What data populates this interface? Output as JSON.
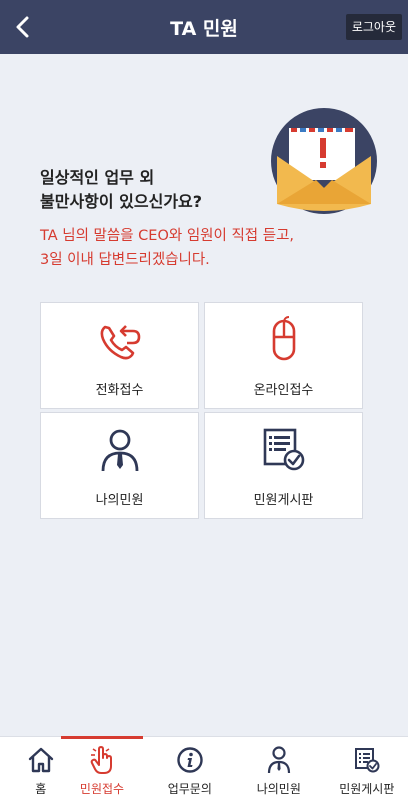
{
  "header": {
    "title": "TA 민원",
    "logout_label": "로그아웃"
  },
  "intro": {
    "headline_line1": "일상적인 업무 외",
    "headline_line2": "불만사항이 있으신가요?",
    "sub_line1": "TA 님의 말씀을 CEO와 임원이 직접 듣고,",
    "sub_line2": "3일 이내 답변드리겠습니다."
  },
  "menu": {
    "items": [
      {
        "label": "전화접수",
        "icon": "phone-callback-icon"
      },
      {
        "label": "온라인접수",
        "icon": "mouse-icon"
      },
      {
        "label": "나의민원",
        "icon": "person-tie-icon"
      },
      {
        "label": "민원게시판",
        "icon": "board-check-icon"
      }
    ]
  },
  "tabs": {
    "items": [
      {
        "label": "홈",
        "icon": "home-icon"
      },
      {
        "label": "민원접수",
        "icon": "hand-pointer-icon"
      },
      {
        "label": "업무문의",
        "icon": "info-icon"
      },
      {
        "label": "나의민원",
        "icon": "person-tie-icon"
      },
      {
        "label": "민원게시판",
        "icon": "board-check-icon"
      }
    ],
    "active_index": 1
  },
  "colors": {
    "header_bg": "#3b4464",
    "accent": "#d63b30",
    "navy_icon": "#2f3856",
    "background": "#eceff5"
  }
}
